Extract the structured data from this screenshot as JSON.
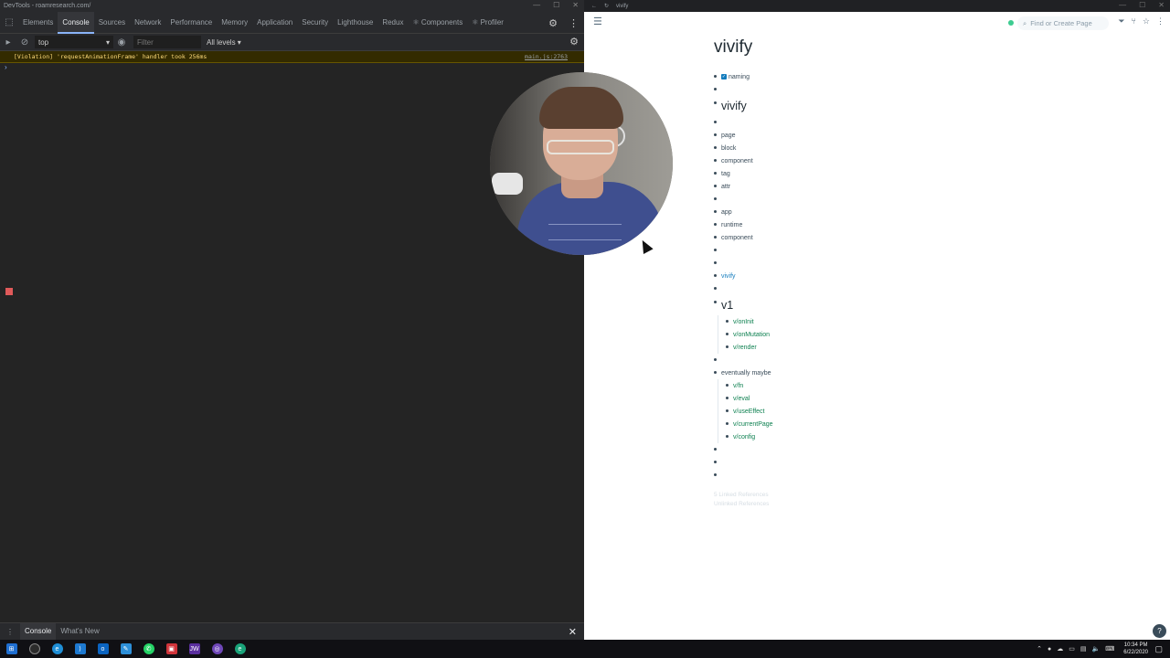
{
  "devtools": {
    "window_title": "DevTools - roamresearch.com/",
    "tabs": [
      {
        "label": "Elements"
      },
      {
        "label": "Console",
        "active": true
      },
      {
        "label": "Sources"
      },
      {
        "label": "Network"
      },
      {
        "label": "Performance"
      },
      {
        "label": "Memory"
      },
      {
        "label": "Application"
      },
      {
        "label": "Security"
      },
      {
        "label": "Lighthouse"
      },
      {
        "label": "Redux"
      },
      {
        "label": "⚛ Components"
      },
      {
        "label": "⚛ Profiler"
      }
    ],
    "context_value": "top",
    "filter_placeholder": "Filter",
    "levels_label": "All levels ▾",
    "violation_message": "[Violation] 'requestAnimationFrame' handler took 256ms",
    "violation_source": "main.js:2763",
    "prompt_symbol": "›",
    "drawer_tabs": [
      "Console",
      "What's New"
    ],
    "drawer_close": "✕"
  },
  "browser": {
    "tab_title": "vivify"
  },
  "roam": {
    "search_placeholder": "Find or Create Page",
    "page_title": "vivify",
    "items": {
      "naming": "naming",
      "vivify_h": "vivify",
      "page": "page",
      "block": "block",
      "component1": "component",
      "tag": "tag",
      "attr": "attr",
      "app": "app",
      "runtime": "runtime",
      "component2": "component",
      "vivify_link": "vivify",
      "v1_h": "v1",
      "onInit": "v/onInit",
      "onMutation": "v/onMutation",
      "render": "v/render",
      "eventually": "eventually maybe",
      "fn": "v/fn",
      "eval": "v/eval",
      "useEffect": "v/useEffect",
      "currentPage": "v/currentPage",
      "config": "v/config"
    },
    "linked_refs": "5 Linked References",
    "unlinked_refs": "Unlinked References",
    "help": "?"
  },
  "taskbar": {
    "time": "10:34 PM",
    "date": "6/22/2020"
  },
  "colors": {
    "devtools_bg": "#242424",
    "roam_link": "#0d8050",
    "violation_bg": "#332b00"
  }
}
